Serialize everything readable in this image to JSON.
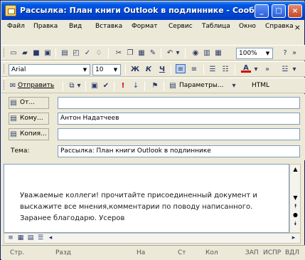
{
  "window": {
    "title": "Рассылка: План книги Outlook в подлиннике - Сообщен...",
    "min_label": "_",
    "max_label": "□",
    "close_label": "×"
  },
  "menu": {
    "items": [
      "Файл",
      "Правка",
      "Вид",
      "Вставка",
      "Формат",
      "Сервис",
      "Таблица",
      "Окно",
      "Справка"
    ],
    "close": "×"
  },
  "toolbar": {
    "zoom": "100%"
  },
  "format": {
    "font": "Arial",
    "size": "10",
    "bold": "Ж",
    "italic": "К",
    "underline": "Ч",
    "font_color_letter": "А"
  },
  "send_bar": {
    "send": "Отправить",
    "importance_high": "!",
    "importance_low": "↓",
    "options": "Параметры...",
    "format": "HTML"
  },
  "header": {
    "from_label": "От...",
    "to_label": "Кому...",
    "to_value": "Антон Надатчеев",
    "cc_label": "Копия...",
    "subject_label": "Тема:",
    "subject_value": "Рассылка: План книги Outlook в подлиннике"
  },
  "body": {
    "lines": [
      "Уважаемые коллеги! прочитайте присоединенный документ и",
      "выскажите все мнения,комментарии по поводу написанного.",
      "Заранее благодарю. Усеров"
    ]
  },
  "status": {
    "page": "Стр.",
    "section": "Разд",
    "at": "На",
    "line": "Ст",
    "col": "Кол",
    "rec": "ЗАП",
    "trk": "ИСПР",
    "ext": "ВДЛ"
  }
}
